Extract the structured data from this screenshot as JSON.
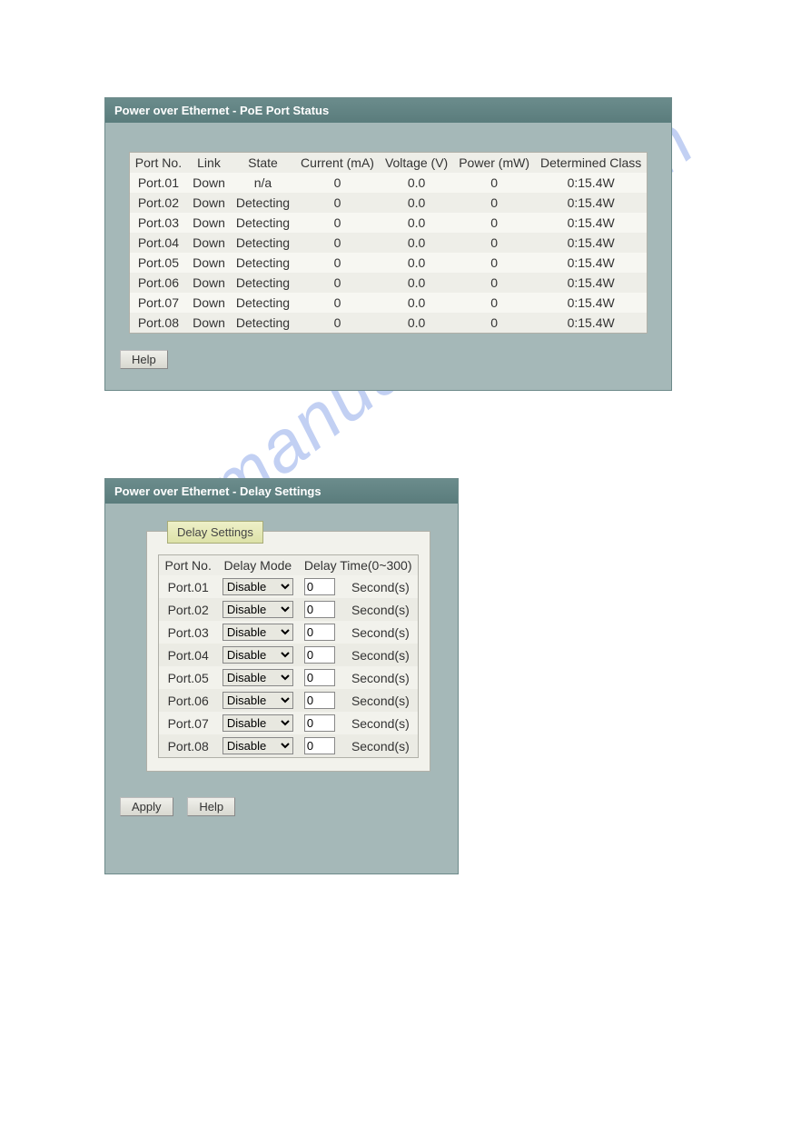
{
  "watermark": "manualshive.com",
  "panel1": {
    "title": "Power over Ethernet - PoE Port Status",
    "headers": [
      "Port No.",
      "Link",
      "State",
      "Current (mA)",
      "Voltage (V)",
      "Power (mW)",
      "Determined Class"
    ],
    "rows": [
      {
        "port": "Port.01",
        "link": "Down",
        "state": "n/a",
        "current": "0",
        "voltage": "0.0",
        "power": "0",
        "class": "0:15.4W"
      },
      {
        "port": "Port.02",
        "link": "Down",
        "state": "Detecting",
        "current": "0",
        "voltage": "0.0",
        "power": "0",
        "class": "0:15.4W"
      },
      {
        "port": "Port.03",
        "link": "Down",
        "state": "Detecting",
        "current": "0",
        "voltage": "0.0",
        "power": "0",
        "class": "0:15.4W"
      },
      {
        "port": "Port.04",
        "link": "Down",
        "state": "Detecting",
        "current": "0",
        "voltage": "0.0",
        "power": "0",
        "class": "0:15.4W"
      },
      {
        "port": "Port.05",
        "link": "Down",
        "state": "Detecting",
        "current": "0",
        "voltage": "0.0",
        "power": "0",
        "class": "0:15.4W"
      },
      {
        "port": "Port.06",
        "link": "Down",
        "state": "Detecting",
        "current": "0",
        "voltage": "0.0",
        "power": "0",
        "class": "0:15.4W"
      },
      {
        "port": "Port.07",
        "link": "Down",
        "state": "Detecting",
        "current": "0",
        "voltage": "0.0",
        "power": "0",
        "class": "0:15.4W"
      },
      {
        "port": "Port.08",
        "link": "Down",
        "state": "Detecting",
        "current": "0",
        "voltage": "0.0",
        "power": "0",
        "class": "0:15.4W"
      }
    ],
    "help_label": "Help"
  },
  "panel2": {
    "title": "Power over Ethernet - Delay Settings",
    "legend": "Delay Settings",
    "headers": [
      "Port No.",
      "Delay Mode",
      "Delay Time(0~300)"
    ],
    "suffix": "Second(s)",
    "mode_option": "Disable",
    "rows": [
      {
        "port": "Port.01",
        "mode": "Disable",
        "time": "0"
      },
      {
        "port": "Port.02",
        "mode": "Disable",
        "time": "0"
      },
      {
        "port": "Port.03",
        "mode": "Disable",
        "time": "0"
      },
      {
        "port": "Port.04",
        "mode": "Disable",
        "time": "0"
      },
      {
        "port": "Port.05",
        "mode": "Disable",
        "time": "0"
      },
      {
        "port": "Port.06",
        "mode": "Disable",
        "time": "0"
      },
      {
        "port": "Port.07",
        "mode": "Disable",
        "time": "0"
      },
      {
        "port": "Port.08",
        "mode": "Disable",
        "time": "0"
      }
    ],
    "apply_label": "Apply",
    "help_label": "Help"
  }
}
